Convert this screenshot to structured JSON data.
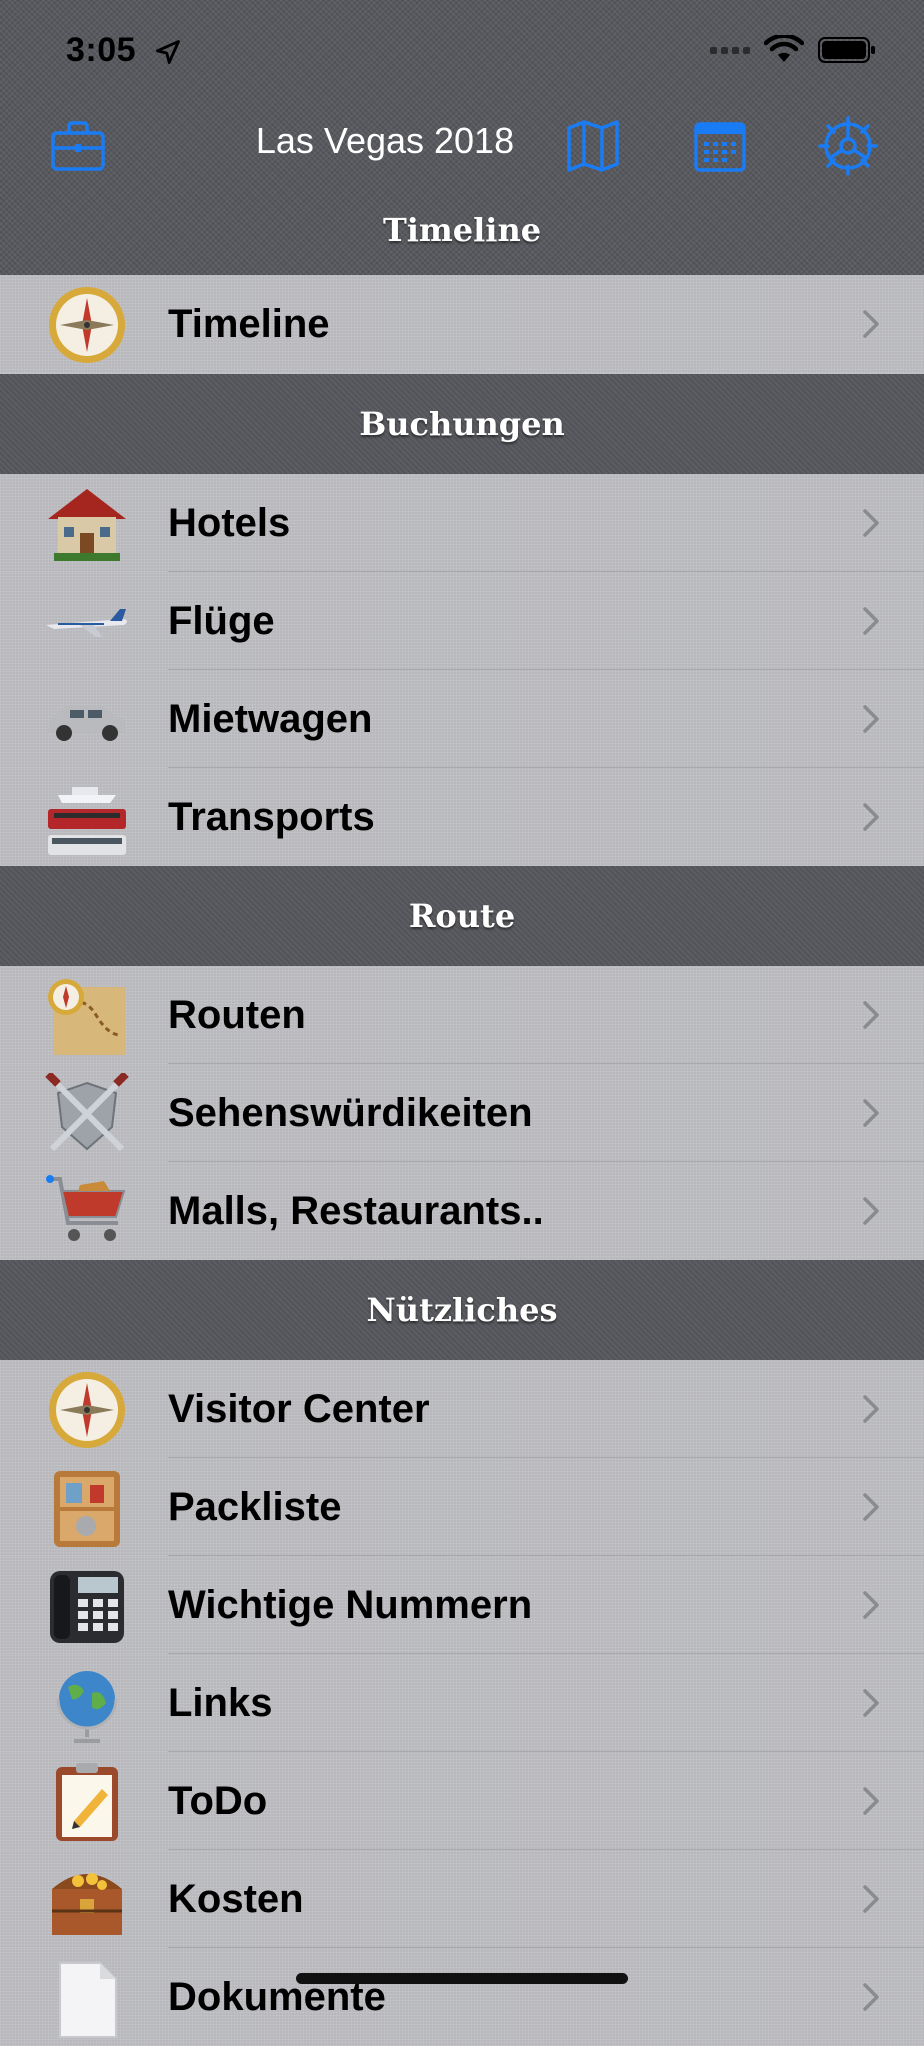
{
  "status_bar": {
    "time": "3:05"
  },
  "nav": {
    "title": "Las Vegas 2018"
  },
  "sections": [
    {
      "title": "Timeline",
      "items": [
        {
          "label": "Timeline",
          "icon": "compass-icon"
        }
      ]
    },
    {
      "title": "Buchungen",
      "items": [
        {
          "label": "Hotels",
          "icon": "house-icon"
        },
        {
          "label": "Flüge",
          "icon": "airplane-icon"
        },
        {
          "label": "Mietwagen",
          "icon": "car-icon"
        },
        {
          "label": "Transports",
          "icon": "transport-icon"
        }
      ]
    },
    {
      "title": "Route",
      "items": [
        {
          "label": "Routen",
          "icon": "map-icon"
        },
        {
          "label": "Sehenswürdikeiten",
          "icon": "shield-swords-icon"
        },
        {
          "label": "Malls, Restaurants..",
          "icon": "shopping-cart-icon"
        }
      ]
    },
    {
      "title": "Nützliches",
      "items": [
        {
          "label": "Visitor Center",
          "icon": "compass-icon"
        },
        {
          "label": "Packliste",
          "icon": "cabinet-icon"
        },
        {
          "label": "Wichtige Nummern",
          "icon": "phone-icon"
        },
        {
          "label": "Links",
          "icon": "globe-icon"
        },
        {
          "label": "ToDo",
          "icon": "clipboard-icon"
        },
        {
          "label": "Kosten",
          "icon": "treasure-chest-icon"
        },
        {
          "label": "Dokumente",
          "icon": "document-icon"
        }
      ]
    }
  ],
  "colors": {
    "accent": "#1a7cf5",
    "header_bg": "#56575c",
    "row_bg": "#bfc0c4"
  }
}
